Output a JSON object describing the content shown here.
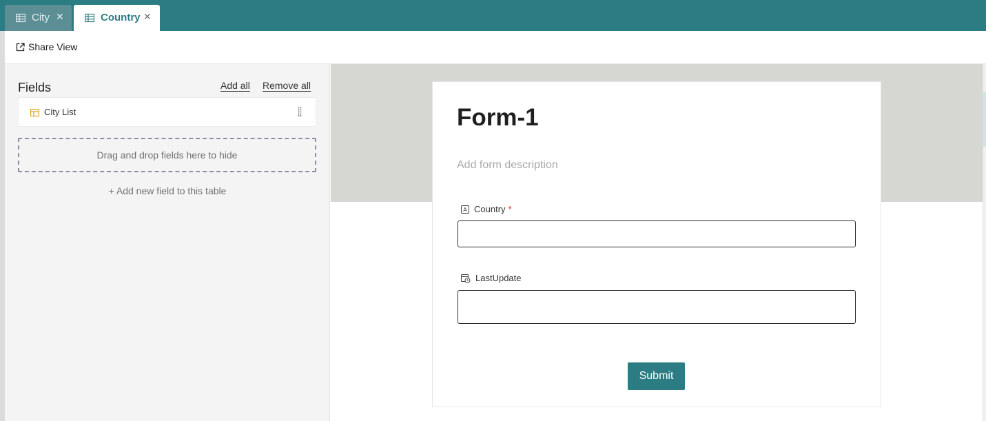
{
  "tabs": [
    {
      "label": "City",
      "icon": "table-icon",
      "active": false
    },
    {
      "label": "Country",
      "icon": "table-icon",
      "active": true
    }
  ],
  "toolbar": {
    "share_label": "Share View"
  },
  "sidebar": {
    "title": "Fields",
    "add_all": "Add all",
    "remove_all": "Remove all",
    "fields": [
      {
        "label": "City List",
        "icon": "link-table-icon"
      }
    ],
    "dropzone_text": "Drag and drop fields here to hide",
    "add_field": "+ Add new field to this table"
  },
  "form": {
    "title": "Form-1",
    "description_placeholder": "Add form description",
    "fields": [
      {
        "label": "Country",
        "required": true,
        "required_mark": "*",
        "icon": "text-field-icon",
        "value": ""
      },
      {
        "label": "LastUpdate",
        "required": false,
        "icon": "datetime-icon",
        "value": ""
      }
    ],
    "submit_label": "Submit"
  },
  "colors": {
    "accent": "#2c7c83",
    "banner": "#d6d6d3",
    "sidebar_bg": "#f4f4f4",
    "required": "#d03030"
  }
}
